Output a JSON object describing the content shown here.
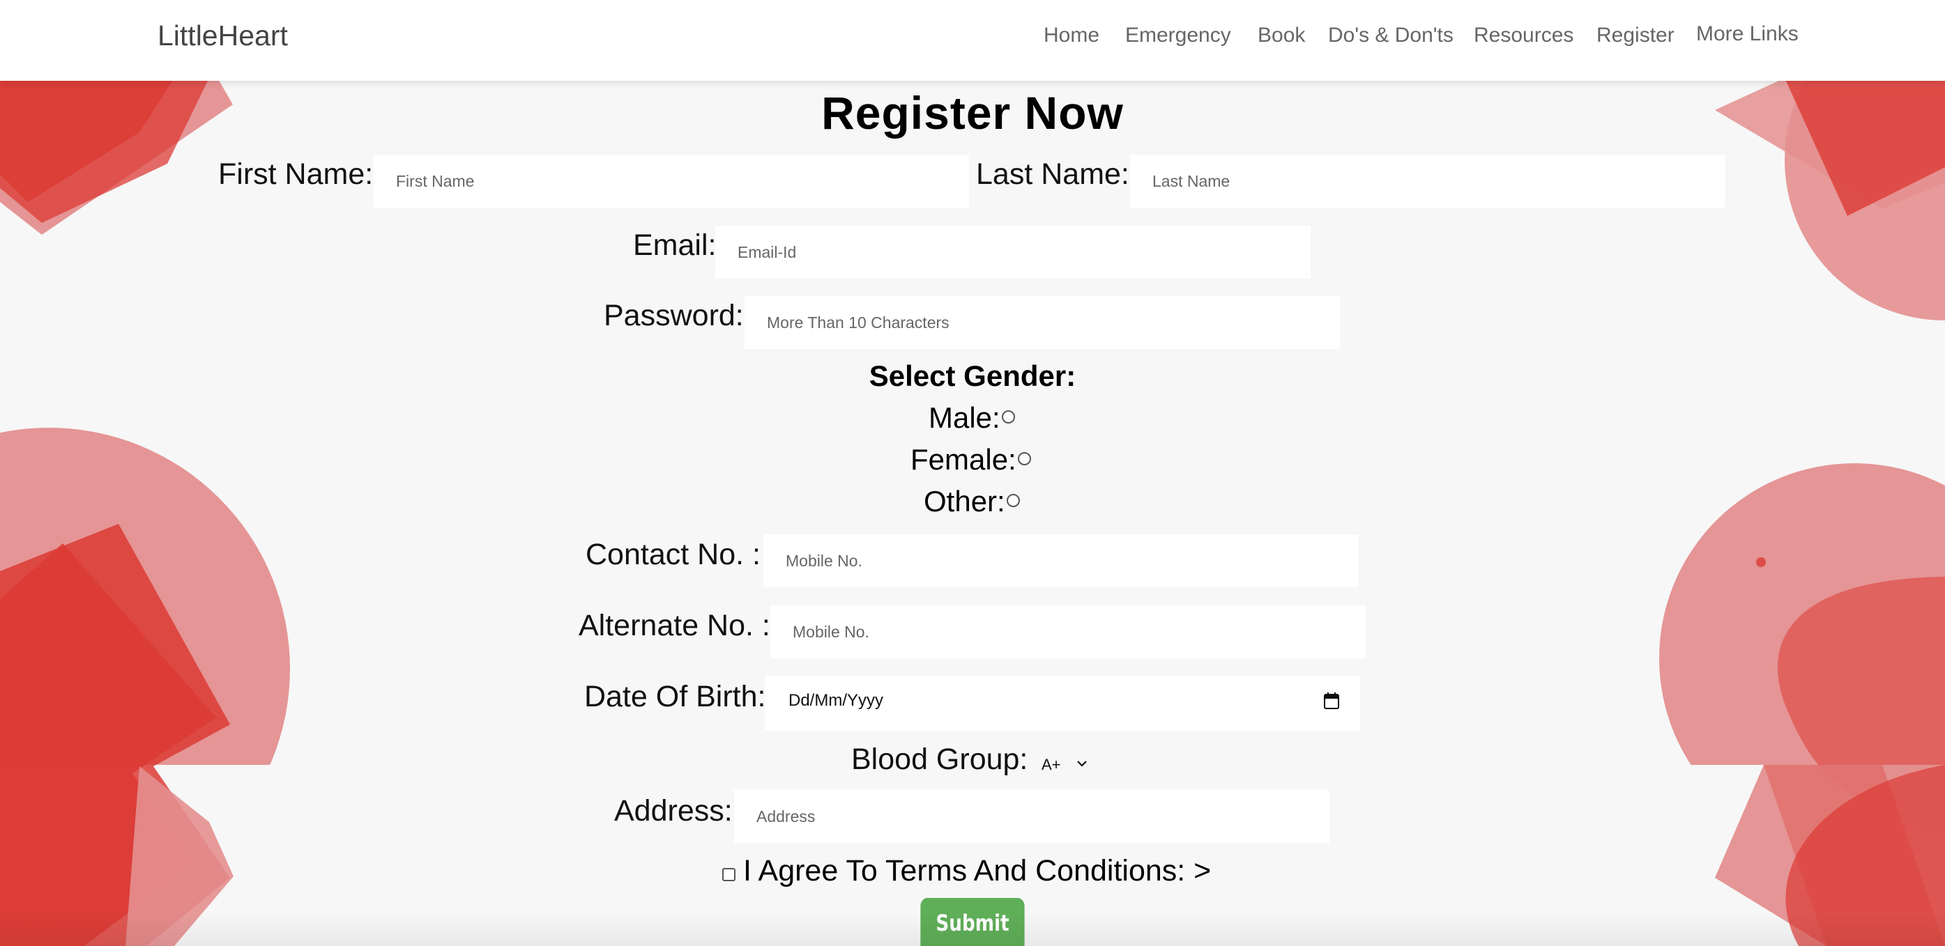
{
  "nav": {
    "brand": "LittleHeart",
    "links": [
      "Home",
      "Emergency",
      "Book",
      "Do's & Don'ts",
      "Resources",
      "Register",
      "More Links"
    ]
  },
  "form": {
    "title": "Register Now",
    "first_name": {
      "label": "First Name:",
      "placeholder": "First Name"
    },
    "last_name": {
      "label": "Last Name:",
      "placeholder": "Last Name"
    },
    "email": {
      "label": "Email:",
      "placeholder": "Email-Id"
    },
    "password": {
      "label": "Password:",
      "placeholder": "More Than 10 Characters"
    },
    "gender": {
      "title": "Select Gender:",
      "options": [
        "Male:",
        "Female:",
        "Other:"
      ]
    },
    "contact": {
      "label": "Contact No. :",
      "placeholder": "Mobile No."
    },
    "alternate": {
      "label": "Alternate No. :",
      "placeholder": "Mobile No."
    },
    "dob": {
      "label": "Date Of Birth:",
      "value": "Dd/Mm/Yyyy"
    },
    "blood_group": {
      "label": "Blood Group:",
      "selected": "A+"
    },
    "address": {
      "label": "Address:",
      "placeholder": "Address"
    },
    "terms": {
      "label": "I Agree To Terms And Conditions: >",
      "checked": false
    },
    "submit_label": "Submit"
  },
  "colors": {
    "accent_red": "#dc3b35",
    "light_red": "#e48f8f",
    "submit_green": "#5fae58",
    "background": "#f7f7f7"
  }
}
